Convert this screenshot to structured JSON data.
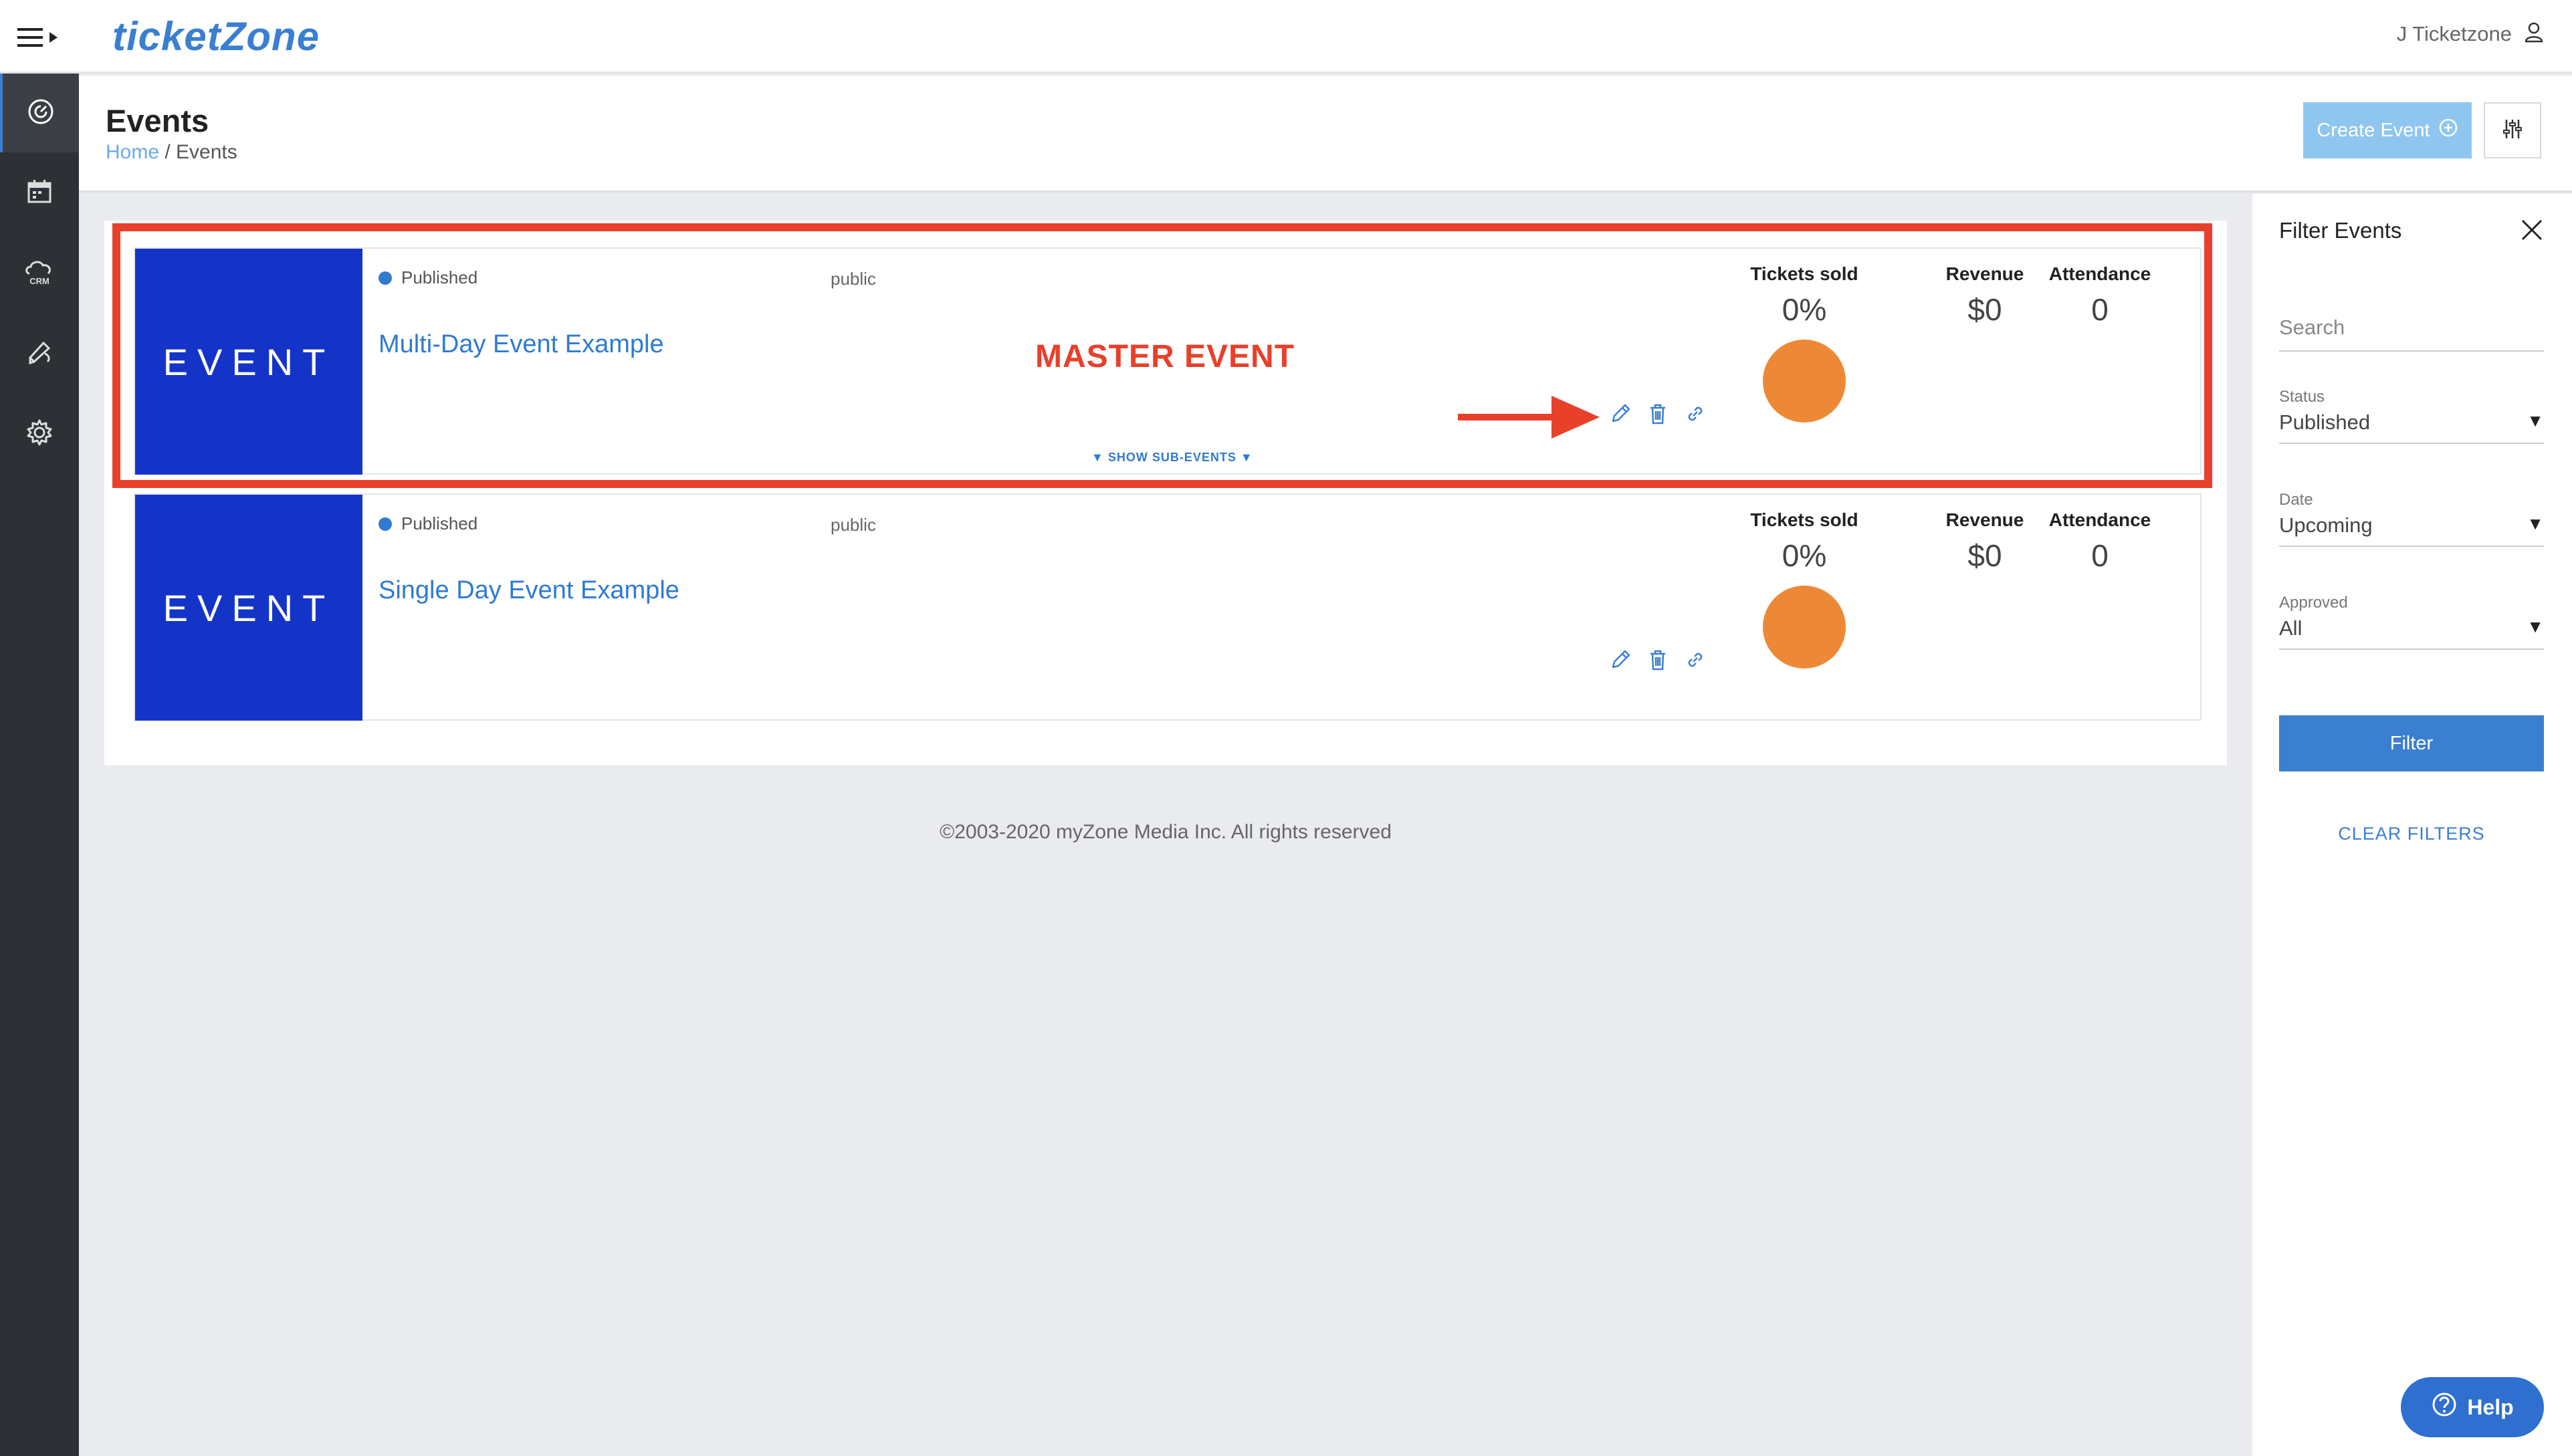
{
  "app": {
    "logo": "ticketZone",
    "user_name": "J Ticketzone"
  },
  "sidebar": {
    "items": [
      {
        "icon": "dashboard-icon",
        "active": true
      },
      {
        "icon": "calendar-icon",
        "active": false
      },
      {
        "icon": "crm-icon",
        "active": false
      },
      {
        "icon": "marketing-icon",
        "active": false
      },
      {
        "icon": "settings-icon",
        "active": false
      }
    ]
  },
  "header": {
    "title": "Events",
    "breadcrumb_home": "Home",
    "breadcrumb_sep": " / ",
    "breadcrumb_current": "Events",
    "create_label": "Create Event"
  },
  "events": [
    {
      "thumb_text": "EVENT",
      "status": "Published",
      "visibility": "public",
      "title": "Multi-Day Event Example",
      "sub_events_label": "▼ SHOW SUB-EVENTS ▼",
      "tickets_label": "Tickets sold",
      "tickets_value": "0%",
      "revenue_label": "Revenue",
      "revenue_value": "$0",
      "attendance_label": "Attendance",
      "attendance_value": "0"
    },
    {
      "thumb_text": "EVENT",
      "status": "Published",
      "visibility": "public",
      "title": "Single Day Event Example",
      "tickets_label": "Tickets sold",
      "tickets_value": "0%",
      "revenue_label": "Revenue",
      "revenue_value": "$0",
      "attendance_label": "Attendance",
      "attendance_value": "0"
    }
  ],
  "annotation": {
    "label": "MASTER EVENT",
    "color": "#e8402a"
  },
  "footer": "©2003-2020 myZone Media Inc. All rights reserved",
  "filter": {
    "title": "Filter Events",
    "search_placeholder": "Search",
    "status_label": "Status",
    "status_value": "Published",
    "date_label": "Date",
    "date_value": "Upcoming",
    "approved_label": "Approved",
    "approved_value": "All",
    "filter_button": "Filter",
    "clear_label": "CLEAR FILTERS"
  },
  "help_label": "Help",
  "colors": {
    "accent": "#3a7fd0",
    "thumb": "#1434c8",
    "pie": "#ed8936"
  }
}
